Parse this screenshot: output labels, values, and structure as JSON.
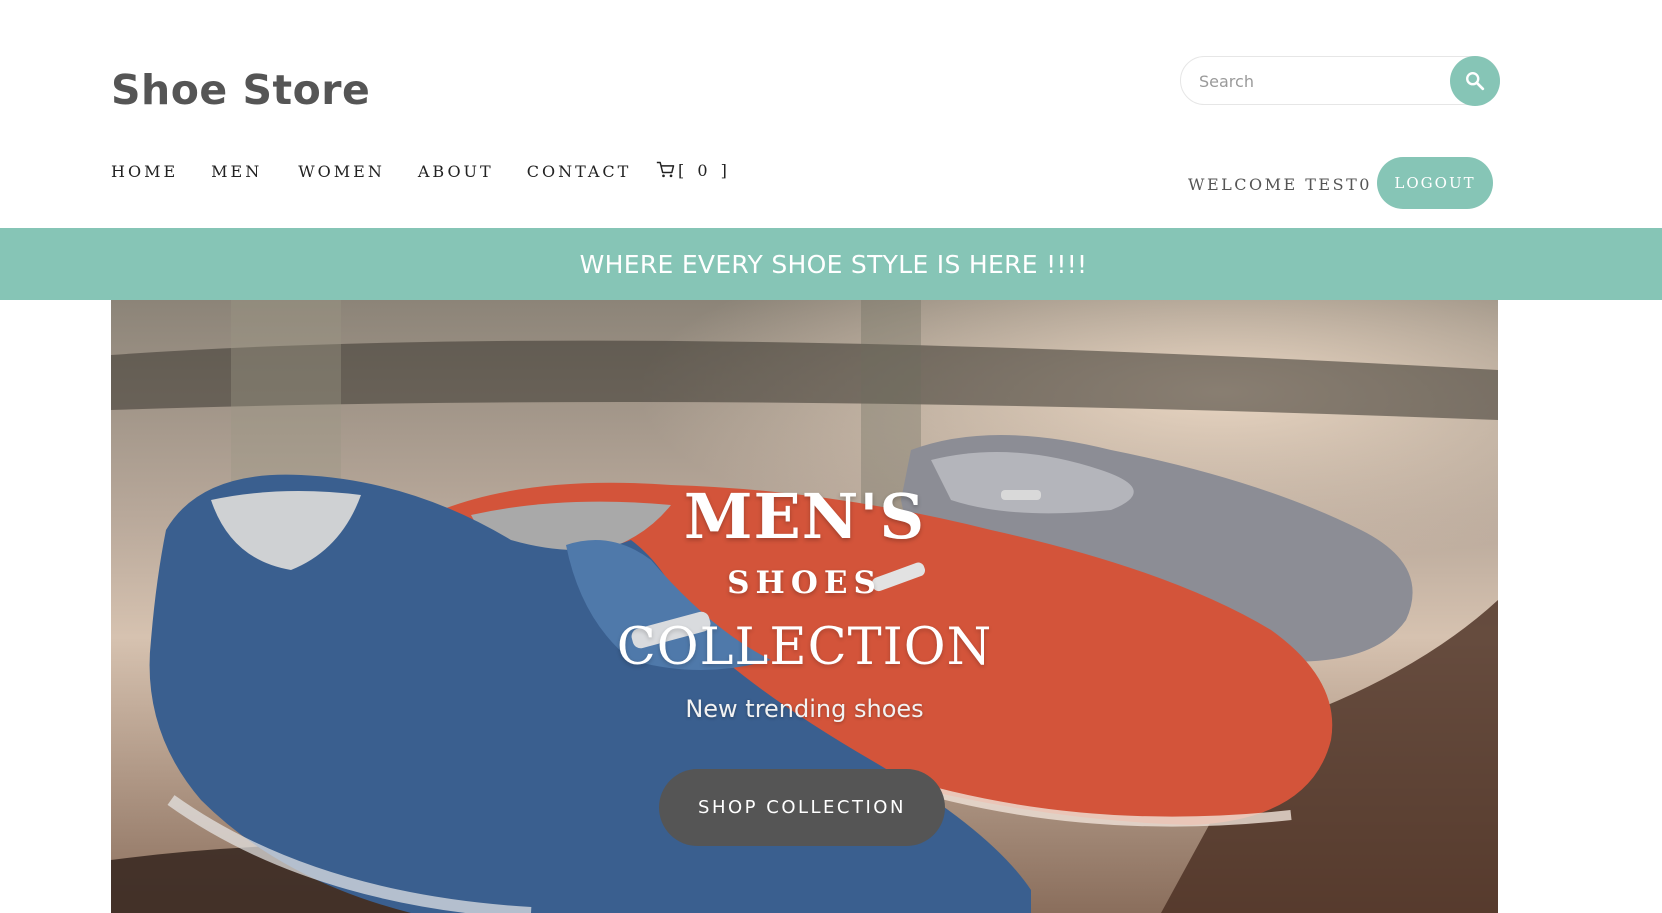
{
  "brand": {
    "title": "Shoe Store"
  },
  "search": {
    "placeholder": "Search",
    "value": ""
  },
  "nav": {
    "items": [
      {
        "label": "HOME"
      },
      {
        "label": "MEN"
      },
      {
        "label": "WOMEN"
      },
      {
        "label": "ABOUT"
      },
      {
        "label": "CONTACT"
      }
    ],
    "cart_label": "[ 0 ]"
  },
  "user": {
    "welcome": "WELCOME TEST0",
    "logout_label": "LOGOUT"
  },
  "banner": {
    "text": "WHERE EVERY SHOE STYLE IS HERE !!!!"
  },
  "hero": {
    "title": "MEN'S",
    "subtitle": "SHOES",
    "collection": "COLLECTION",
    "tagline": "New trending shoes",
    "button_label": "SHOP COLLECTION"
  },
  "icons": {
    "search": "search-icon",
    "cart": "cart-icon"
  },
  "colors": {
    "accent": "#86c5b6",
    "button_dark": "#555555",
    "brand_text": "#555555"
  }
}
